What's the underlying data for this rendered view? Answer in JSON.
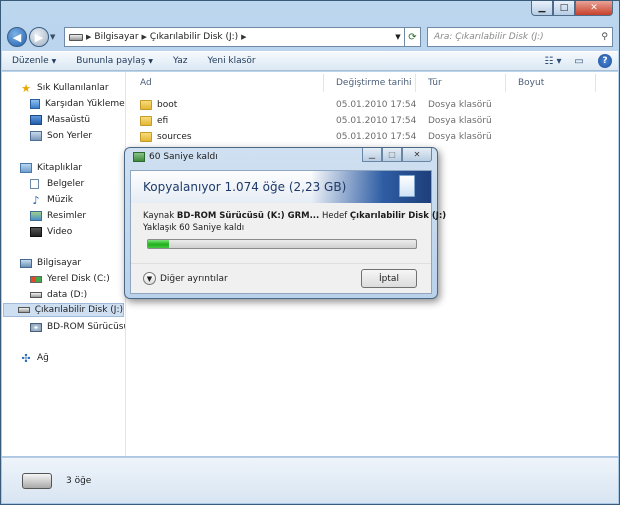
{
  "address": {
    "path": [
      "Bilgisayar",
      "Çıkarılabilir Disk (J:)"
    ],
    "search_placeholder": "Ara: Çıkarılabilir Disk (J:)"
  },
  "toolbar": {
    "organize": "Düzenle",
    "share": "Bununla paylaş",
    "burn": "Yaz",
    "new_folder": "Yeni klasör"
  },
  "nav": {
    "favorites": "Sık Kullanılanlar",
    "downloads": "Karşıdan Yüklemeler",
    "desktop": "Masaüstü",
    "recent": "Son Yerler",
    "libraries": "Kitaplıklar",
    "documents": "Belgeler",
    "music": "Müzik",
    "pictures": "Resimler",
    "videos": "Video",
    "computer": "Bilgisayar",
    "local_disk": "Yerel Disk (C:)",
    "data_disk": "data (D:)",
    "removable": "Çıkarılabilir Disk (J:)",
    "bdrom": "BD-ROM Sürücüsü (",
    "network": "Ağ"
  },
  "columns": {
    "name": "Ad",
    "date": "Değiştirme tarihi",
    "type": "Tür",
    "size": "Boyut"
  },
  "files": [
    {
      "name": "boot",
      "date": "05.01.2010 17:54",
      "type": "Dosya klasörü"
    },
    {
      "name": "efi",
      "date": "05.01.2010 17:54",
      "type": "Dosya klasörü"
    },
    {
      "name": "sources",
      "date": "05.01.2010 17:54",
      "type": "Dosya klasörü"
    }
  ],
  "status": {
    "count": "3 öğe"
  },
  "dialog": {
    "title": "60 Saniye kaldı",
    "heading": "Kopyalanıyor 1.074 öğe (2,23 GB)",
    "from_label": "Kaynak",
    "from_value": "BD-ROM Sürücüsü (K:) GRM...",
    "to_label": "Hedef",
    "to_value": "Çıkarılabilir Disk (J:)",
    "remaining": "Yaklaşık 60 Saniye kaldı",
    "progress": 0.08,
    "more_details": "Diğer ayrıntılar",
    "cancel": "İptal"
  }
}
